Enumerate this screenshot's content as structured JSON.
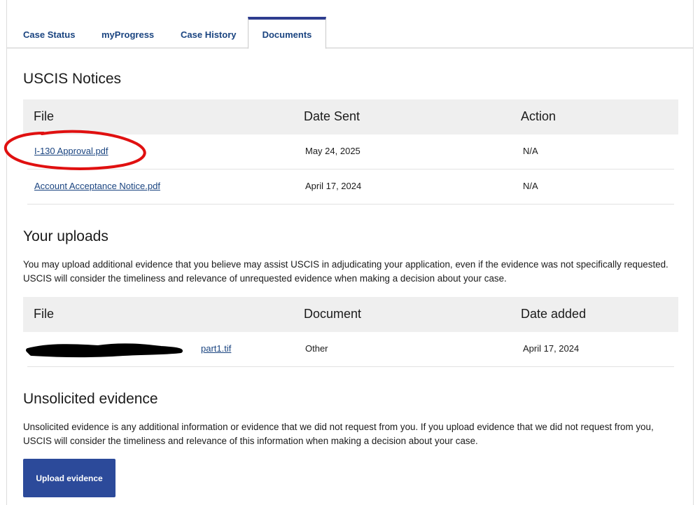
{
  "tabs": [
    {
      "label": "Case Status"
    },
    {
      "label": "myProgress"
    },
    {
      "label": "Case History"
    },
    {
      "label": "Documents"
    }
  ],
  "notices": {
    "title": "USCIS Notices",
    "headers": [
      "File",
      "Date Sent",
      "Action"
    ],
    "rows": [
      {
        "file": "I-130 Approval.pdf",
        "date": "May 24, 2025",
        "action": "N/A"
      },
      {
        "file": "Account Acceptance Notice.pdf",
        "date": "April 17, 2024",
        "action": "N/A"
      }
    ]
  },
  "uploads": {
    "title": "Your uploads",
    "description": "You may upload additional evidence that you believe may assist USCIS in adjudicating your application, even if the evidence was not specifically requested. USCIS will consider the timeliness and relevance of unrequested evidence when making a decision about your case.",
    "headers": [
      "File",
      "Document",
      "Date added"
    ],
    "rows": [
      {
        "file": "part1.tif",
        "document": "Other",
        "date": "April 17, 2024"
      }
    ]
  },
  "unsolicited": {
    "title": "Unsolicited evidence",
    "description": "Unsolicited evidence is any additional information or evidence that we did not request from you. If you upload evidence that we did not request from you, USCIS will consider the timeliness and relevance of this information when making a decision about your case.",
    "button_label": "Upload evidence"
  },
  "colors": {
    "link": "#1a4480",
    "button": "#2c4a9a",
    "tab_active_border": "#2e3d8f",
    "annotation": "#e01010",
    "redaction": "#000000"
  }
}
